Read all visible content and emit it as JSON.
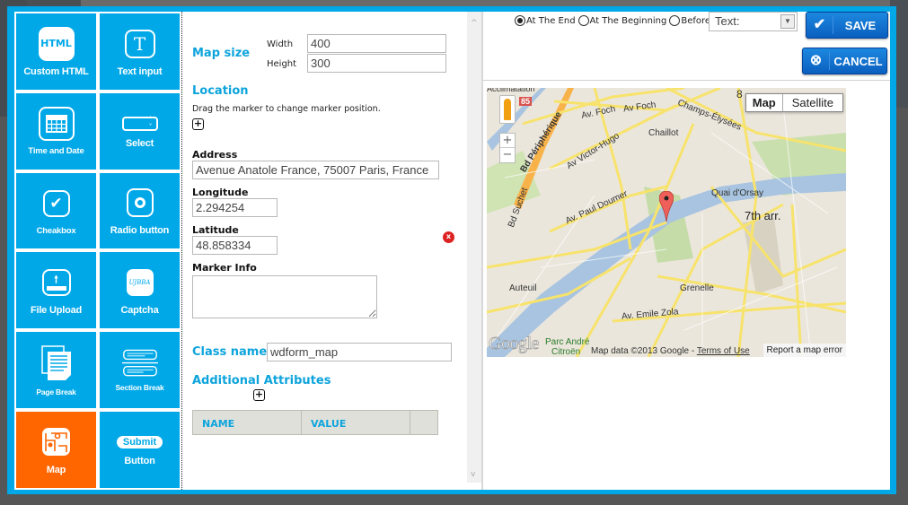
{
  "tiles": [
    {
      "label": "Custom HTML",
      "icon": "html-icon",
      "icon_text": "HTML",
      "active": false
    },
    {
      "label": "Text input",
      "icon": "text-input-icon",
      "icon_text": "T",
      "active": false
    },
    {
      "label": "Time and Date",
      "icon": "calendar-icon",
      "active": false
    },
    {
      "label": "Select",
      "icon": "select-icon",
      "active": false
    },
    {
      "label": "Cheakbox",
      "icon": "checkbox-icon",
      "active": false
    },
    {
      "label": "Radio button",
      "icon": "radio-icon",
      "active": false
    },
    {
      "label": "File Upload",
      "icon": "upload-icon",
      "active": false
    },
    {
      "label": "Captcha",
      "icon": "captcha-icon",
      "icon_text": "UJBBA",
      "active": false
    },
    {
      "label": "Page Break",
      "icon": "page-break-icon",
      "active": false
    },
    {
      "label": "Section Break",
      "icon": "section-break-icon",
      "active": false
    },
    {
      "label": "Map",
      "icon": "map-icon",
      "active": true
    },
    {
      "label": "Button",
      "icon": "submit-icon",
      "icon_text": "Submit",
      "active": false
    }
  ],
  "form": {
    "map_size_title": "Map size",
    "width_label": "Width",
    "width_value": "400",
    "height_label": "Height",
    "height_value": "300",
    "location_title": "Location",
    "location_hint": "Drag the marker to change marker position.",
    "add_marker": "+",
    "address_label": "Address",
    "address_value": "Avenue Anatole France, 75007 Paris, France",
    "longitude_label": "Longitude",
    "longitude_value": "2.294254",
    "latitude_label": "Latitude",
    "latitude_value": "48.858334",
    "marker_info_label": "Marker Info",
    "marker_info_value": "",
    "remove_marker": "x",
    "class_name_label": "Class name",
    "class_name_value": "wdform_map",
    "additional_attributes_title": "Additional Attributes",
    "add_attribute": "+",
    "attr_columns": [
      "NAME",
      "VALUE",
      ""
    ]
  },
  "toolbar": {
    "position_options": [
      {
        "label": "At The End",
        "checked": true
      },
      {
        "label": "At The Beginning",
        "checked": false
      },
      {
        "label": "Before",
        "checked": false
      }
    ],
    "before_select_value": "Text:",
    "save_label": "SAVE",
    "cancel_label": "CANCEL"
  },
  "map": {
    "type_map": "Map",
    "type_satellite": "Satellite",
    "zoom_in": "+",
    "zoom_out": "−",
    "shield": "85",
    "labels": {
      "av_foch1": "Av. Foch",
      "av_foch2": "Av Foch",
      "champs": "Champs-Élysées",
      "chaillot": "Chaillot",
      "victor_hugo": "Av Victor-Hugo",
      "peripherique": "Bd Périphérique",
      "suchet": "Bd Suchet",
      "paul_doumer": "Av. Paul Doumer",
      "quai": "Quai d'Orsay",
      "arr7": "7th arr.",
      "auteuil": "Auteuil",
      "grenelle": "Grenelle",
      "zola": "Av. Emile Zola",
      "parc": "Parc André",
      "citroen": "Citroën",
      "arr8": "8"
    },
    "logo": "Google",
    "attribution": "Map data ©2013 Google - ",
    "terms": "Terms of Use",
    "report": "Report a map error"
  },
  "colors": {
    "accent": "#00a8e8",
    "active_tile": "#ff6600",
    "title_blue": "#0da4dc",
    "button_blue": "#0a6fd0"
  }
}
